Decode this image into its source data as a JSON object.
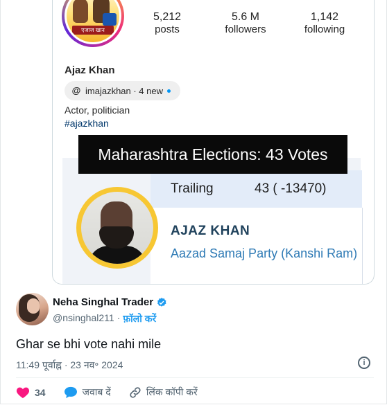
{
  "profile": {
    "posts_count": "5,212",
    "posts_label": "posts",
    "followers_count": "5.6 M",
    "followers_label": "followers",
    "following_count": "1,142",
    "following_label": "following",
    "name": "Ajaz Khan",
    "threads_handle": "imajazkhan · 4 new",
    "bio": "Actor, politician",
    "hashtag": "#ajazkhan",
    "avatar_banner": "एजाज खान"
  },
  "overlay_caption": "Maharashtra Elections: 43 Votes",
  "result_card": {
    "status_label": "Trailing",
    "status_value": "43 ( -13470)",
    "candidate": "AJAZ KHAN",
    "party": "Aazad Samaj Party (Kanshi Ram)"
  },
  "tweet": {
    "author_name": "Neha Singhal Trader",
    "author_handle": "@nsinghal211",
    "separator": "·",
    "follow_label": "फ़ॉलो करें",
    "text": "Ghar se bhi vote nahi mile",
    "timestamp": "11:49 पूर्वाह्न · 23 नव॰ 2024"
  },
  "actions": {
    "likes": "34",
    "reply_label": "जवाब दें",
    "copy_link_label": "लिंक कॉपी करें"
  },
  "colors": {
    "like": "#f91880",
    "reply": "#1d9bf0",
    "verified": "#1d9bf0",
    "link_blue": "#00376b"
  }
}
